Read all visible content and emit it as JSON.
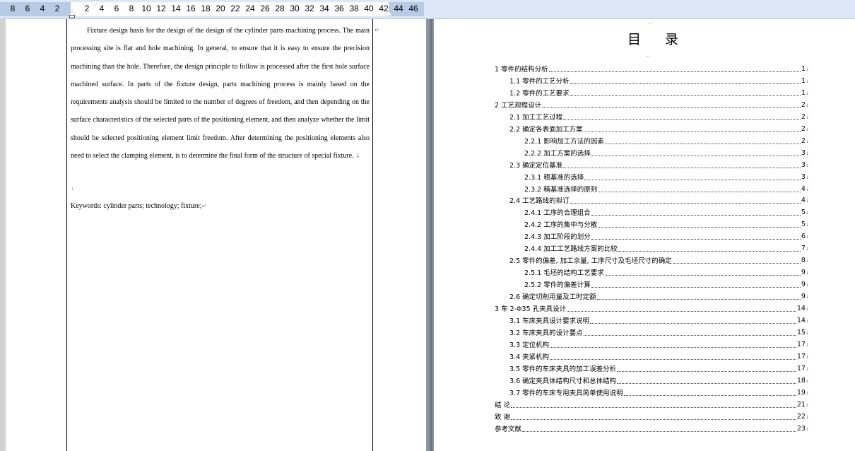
{
  "ruler": {
    "ticks_left": [
      "8",
      "6",
      "4",
      "2"
    ],
    "ticks_right": [
      "2",
      "4",
      "6",
      "8",
      "10",
      "12",
      "14",
      "16",
      "18",
      "20",
      "22",
      "24",
      "26",
      "28",
      "30",
      "32",
      "34",
      "36",
      "38",
      "40",
      "42",
      "44",
      "46"
    ]
  },
  "left_page": {
    "paragraph": "Fixture design basis for the design of the design of the cylinder parts machining process. The main processing site is flat and hole machining. In general, to ensure that it is easy to ensure the precision machining than the hole. Therefore, the design principle to follow is processed after the first hole surface machined surface. In parts of the fixture design, parts machining process is mainly based on the requirements analysis should be limited to the number of degrees of freedom, and then depending on the surface characteristics of the selected parts of the positioning element, and then analyze whether the limit should be selected positioning element limit freedom. After determining the positioning elements also need to select the clamping element, is to determine the final form of the structure of special fixture.",
    "paragraph_mark": "↓",
    "empty_mark": "↓",
    "keywords": "Keywords: cylinder parts; technology; fixture;",
    "keywords_mark": "↵",
    "return_mark": "↵"
  },
  "toc": {
    "title": "目 录",
    "title_mark": "↵",
    "entries": [
      {
        "label": "1   零件的结构分析",
        "page": "1",
        "level": 0
      },
      {
        "label": "1.1 零件的工艺分析",
        "page": "1",
        "level": 1
      },
      {
        "label": "1.2 零件的工艺要求",
        "page": "1",
        "level": 1
      },
      {
        "label": "2 工艺规程设计",
        "page": "2",
        "level": 0
      },
      {
        "label": "2.1  加工工艺过程",
        "page": "2",
        "level": 1
      },
      {
        "label": "2.2 确定各表面加工方案",
        "page": "2",
        "level": 1
      },
      {
        "label": "2.2.1 影响加工方法的因素",
        "page": "2",
        "level": 2
      },
      {
        "label": "2.2.2 加工方案的选择",
        "page": "3",
        "level": 2
      },
      {
        "label": "2.3  确定定位基准",
        "page": "3",
        "level": 1
      },
      {
        "label": "2.3.1 粗基准的选择",
        "page": "3",
        "level": 2
      },
      {
        "label": "2.3.2 精基准选择的原则",
        "page": "4",
        "level": 2
      },
      {
        "label": "2.4 工艺路线的拟订",
        "page": "4",
        "level": 1
      },
      {
        "label": "2.4.1 工序的合理组合",
        "page": "5",
        "level": 2
      },
      {
        "label": "2.4.2 工序的集中与分散",
        "page": "5",
        "level": 2
      },
      {
        "label": "2.4.3 加工阶段的划分",
        "page": "6",
        "level": 2
      },
      {
        "label": "2.4.4 加工工艺路线方案的比较",
        "page": "7",
        "level": 2
      },
      {
        "label": "2.5 零件的偏差, 加工余量, 工序尺寸及毛坯尺寸的确定",
        "page": "8",
        "level": 1
      },
      {
        "label": "2.5.1 毛坯的结构工艺要求",
        "page": "9",
        "level": 2
      },
      {
        "label": "2.5.2 零件的偏差计算",
        "page": "9",
        "level": 2
      },
      {
        "label": "2.6   确定切削用量及工时定额",
        "page": "9",
        "level": 1
      },
      {
        "label": "3 车 2-Φ35 孔夹具设计",
        "page": "14",
        "level": 0
      },
      {
        "label": "3.1  车床夹具设计要求说明",
        "page": "14",
        "level": 1
      },
      {
        "label": "3.2 车床夹具的设计要点",
        "page": "15",
        "level": 1
      },
      {
        "label": "3.3  定位机构",
        "page": "17",
        "level": 1
      },
      {
        "label": "3.4 夹紧机构",
        "page": "17",
        "level": 1
      },
      {
        "label": "3.5 零件的车床夹具的加工误差分析",
        "page": "17",
        "level": 1
      },
      {
        "label": "3.6  确定夹具体结构尺寸和总体结构",
        "page": "18",
        "level": 1
      },
      {
        "label": "3.7  零件的车床专用夹具简单使用说明",
        "page": "19",
        "level": 1
      },
      {
        "label": "结   论",
        "page": "21",
        "level": 0
      },
      {
        "label": "致   谢",
        "page": "22",
        "level": 0
      },
      {
        "label": "参考文献",
        "page": "23",
        "level": 0
      }
    ],
    "entry_mark": "↓"
  }
}
